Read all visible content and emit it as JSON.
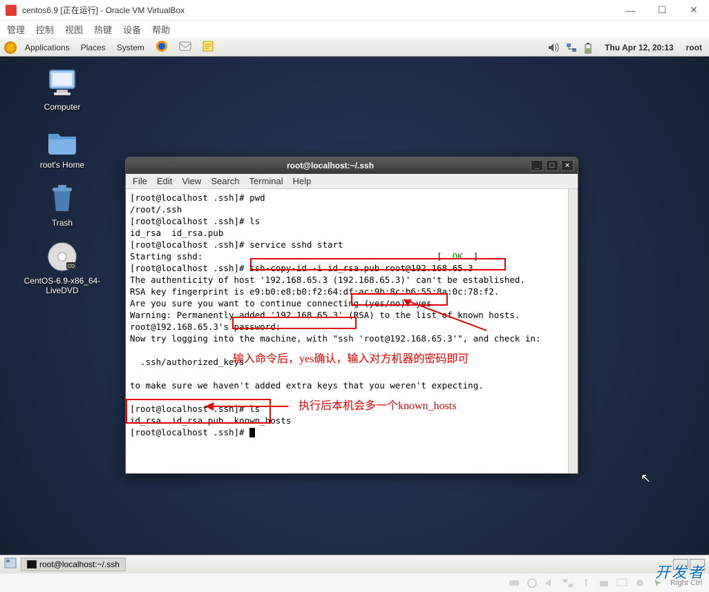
{
  "vbox": {
    "title": "centos6.9 [正在运行] - Oracle VM VirtualBox",
    "menu": {
      "m1": "管理",
      "m2": "控制",
      "m3": "视图",
      "m4": "热键",
      "m5": "设备",
      "m6": "帮助"
    },
    "status_key": "Right Ctrl"
  },
  "gnome": {
    "apps": "Applications",
    "places": "Places",
    "system": "System",
    "clock": "Thu Apr 12, 20:13",
    "user": "root"
  },
  "desktop": {
    "computer": "Computer",
    "home": "root's Home",
    "trash": "Trash",
    "dvd": "CentOS-6.9-x86_64-LiveDVD"
  },
  "terminal": {
    "title": "root@localhost:~/.ssh",
    "menu": {
      "file": "File",
      "edit": "Edit",
      "view": "View",
      "search": "Search",
      "term": "Terminal",
      "help": "Help"
    },
    "lines": {
      "l1": "[root@localhost .ssh]# pwd",
      "l2": "/root/.ssh",
      "l3": "[root@localhost .ssh]# ls",
      "l4": "id_rsa  id_rsa.pub",
      "l5": "[root@localhost .ssh]# service sshd start",
      "l6a": "Starting sshd:                                             [  ",
      "l6ok": "OK",
      "l6b": "  ]",
      "l7": "[root@localhost .ssh]# ssh-copy-id -i id_rsa.pub root@192.168.65.3",
      "l8": "The authenticity of host '192.168.65.3 (192.168.65.3)' can't be established.",
      "l9": "RSA key fingerprint is e9:b0:e8:b0:f2:64:df:ac:9b:8c:b6:55:8a:0c:78:f2.",
      "l10": "Are you sure you want to continue connecting (yes/no)? yes",
      "l11": "Warning: Permanently added '192.168.65.3' (RSA) to the list of known hosts.",
      "l12": "root@192.168.65.3's password:",
      "l13": "Now try logging into the machine, with \"ssh 'root@192.168.65.3'\", and check in:",
      "l14": "",
      "l15": "  .ssh/authorized_keys",
      "l16": "",
      "l17": "to make sure we haven't added extra keys that you weren't expecting.",
      "l18": "",
      "l19": "[root@localhost .ssh]# ls",
      "l20": "id_rsa  id_rsa.pub  known_hosts",
      "l21": "[root@localhost .ssh]# "
    }
  },
  "annotations": {
    "note1": "输入命令后，yes确认，输入对方机器的密码即可",
    "note2": "执行后本机会多一个known_hosts"
  },
  "taskbar": {
    "item1": "root@localhost:~/.ssh"
  },
  "watermark": "开发者"
}
